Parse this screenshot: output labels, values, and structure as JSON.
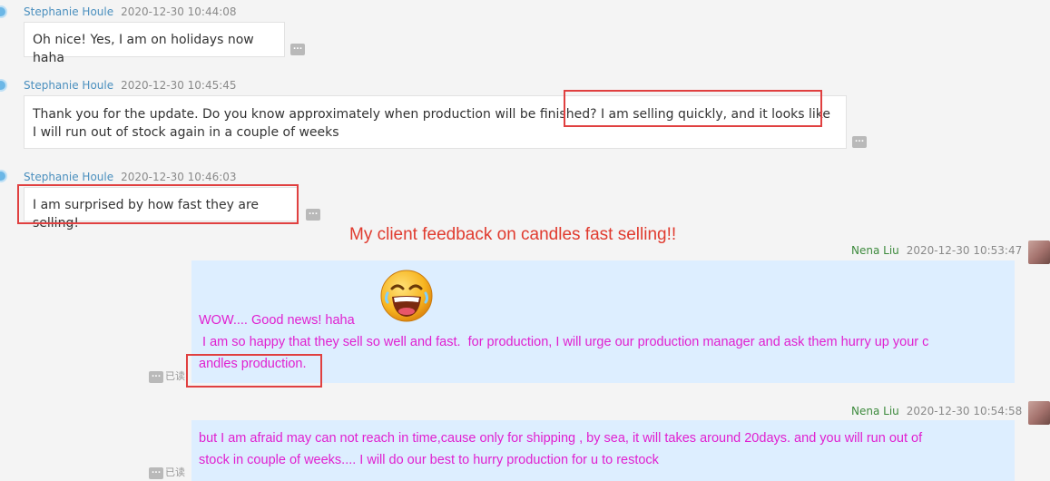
{
  "messages": [
    {
      "sender": "Stephanie Houle",
      "time": "2020-12-30 10:44:08",
      "text": "Oh nice! Yes, I am on holidays now haha"
    },
    {
      "sender": "Stephanie Houle",
      "time": "2020-12-30 10:45:45",
      "text": "Thank you for the update. Do you know approximately when production will be finished? I am selling quickly, and it looks like I will run out of stock again in a couple of weeks"
    },
    {
      "sender": "Stephanie Houle",
      "time": "2020-12-30 10:46:03",
      "text": "I am surprised by how fast they are selling!"
    },
    {
      "sender": "Nena Liu",
      "time": "2020-12-30 10:53:47",
      "line1": "WOW.... Good  news! haha",
      "line2": " I am so happy that they sell so well and fast.  for production, I will urge our production manager and ask them hurry up your c",
      "line3": "andles production.",
      "status": "已读"
    },
    {
      "sender": "Nena Liu",
      "time": "2020-12-30 10:54:58",
      "line1": "but I am afraid may can not reach in time,cause only for shipping , by sea, it will takes around 20days. and you will run out of",
      "line2": "stock in couple of weeks.... I will do our best to hurry production for u to restock",
      "status": "已读"
    }
  ],
  "annotation": "My client feedback on candles fast selling!!",
  "more_glyph": "...",
  "colors": {
    "incoming_bubble": "#ffffff",
    "outgoing_bubble": "#ddeeff",
    "outgoing_text": "#e020d0",
    "highlight": "#e04040",
    "annotation": "#e03a2e"
  },
  "icons": {
    "emoji": "laughing-face-icon",
    "avatar": "user-avatar"
  }
}
